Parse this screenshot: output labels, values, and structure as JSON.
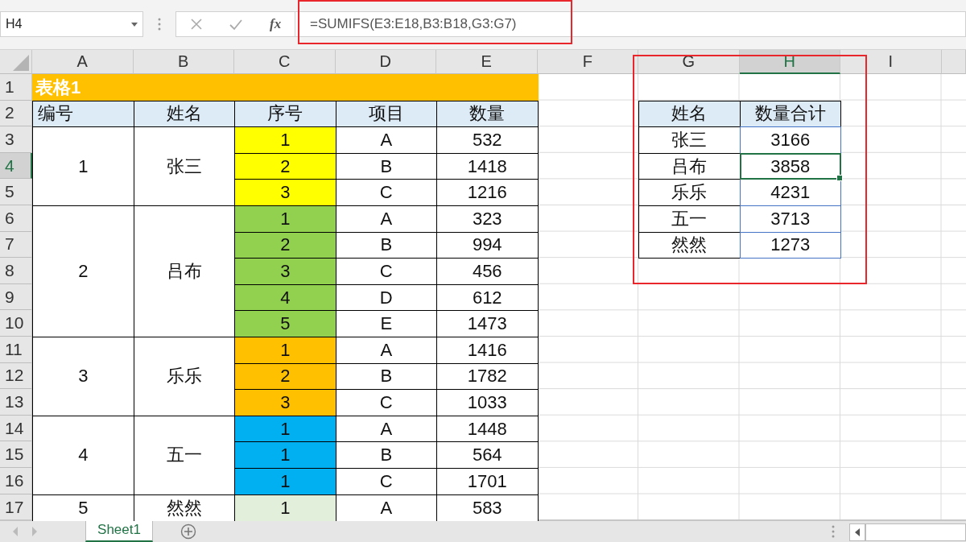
{
  "formula_bar": {
    "name_box": "H4",
    "fx": "fx",
    "formula": "=SUMIFS(E3:E18,B3:B18,G3:G7)"
  },
  "columns": [
    {
      "label": "A",
      "selected": false
    },
    {
      "label": "B",
      "selected": false
    },
    {
      "label": "C",
      "selected": false
    },
    {
      "label": "D",
      "selected": false
    },
    {
      "label": "E",
      "selected": false
    },
    {
      "label": "F",
      "selected": false
    },
    {
      "label": "G",
      "selected": false
    },
    {
      "label": "H",
      "selected": true
    },
    {
      "label": "I",
      "selected": false
    }
  ],
  "rows": [
    {
      "label": "1",
      "selected": false
    },
    {
      "label": "2",
      "selected": false
    },
    {
      "label": "3",
      "selected": false
    },
    {
      "label": "4",
      "selected": true
    },
    {
      "label": "5",
      "selected": false
    },
    {
      "label": "6",
      "selected": false
    },
    {
      "label": "7",
      "selected": false
    },
    {
      "label": "8",
      "selected": false
    },
    {
      "label": "9",
      "selected": false
    },
    {
      "label": "10",
      "selected": false
    },
    {
      "label": "11",
      "selected": false
    },
    {
      "label": "12",
      "selected": false
    },
    {
      "label": "13",
      "selected": false
    },
    {
      "label": "14",
      "selected": false
    },
    {
      "label": "15",
      "selected": false
    },
    {
      "label": "16",
      "selected": false
    },
    {
      "label": "17",
      "selected": false
    }
  ],
  "table": {
    "title": "表格1",
    "headers": [
      "编号",
      "姓名",
      "序号",
      "项目",
      "数量"
    ],
    "groups": [
      {
        "id": "1",
        "name": "张三",
        "items": [
          {
            "seq": "1",
            "color": "#ffff00",
            "item": "A",
            "qty": "532"
          },
          {
            "seq": "2",
            "color": "#ffff00",
            "item": "B",
            "qty": "1418"
          },
          {
            "seq": "3",
            "color": "#ffff00",
            "item": "C",
            "qty": "1216"
          }
        ]
      },
      {
        "id": "2",
        "name": "吕布",
        "items": [
          {
            "seq": "1",
            "color": "#92d050",
            "item": "A",
            "qty": "323"
          },
          {
            "seq": "2",
            "color": "#92d050",
            "item": "B",
            "qty": "994"
          },
          {
            "seq": "3",
            "color": "#92d050",
            "item": "C",
            "qty": "456"
          },
          {
            "seq": "4",
            "color": "#92d050",
            "item": "D",
            "qty": "612"
          },
          {
            "seq": "5",
            "color": "#92d050",
            "item": "E",
            "qty": "1473"
          }
        ]
      },
      {
        "id": "3",
        "name": "乐乐",
        "items": [
          {
            "seq": "1",
            "color": "#ffc000",
            "item": "A",
            "qty": "1416"
          },
          {
            "seq": "2",
            "color": "#ffc000",
            "item": "B",
            "qty": "1782"
          },
          {
            "seq": "3",
            "color": "#ffc000",
            "item": "C",
            "qty": "1033"
          }
        ]
      },
      {
        "id": "4",
        "name": "五一",
        "items": [
          {
            "seq": "1",
            "color": "#00b0f0",
            "item": "A",
            "qty": "1448"
          },
          {
            "seq": "1",
            "color": "#00b0f0",
            "item": "B",
            "qty": "564"
          },
          {
            "seq": "1",
            "color": "#00b0f0",
            "item": "C",
            "qty": "1701"
          }
        ]
      },
      {
        "id": "5",
        "name": "然然",
        "items": [
          {
            "seq": "1",
            "color": "#e2efda",
            "item": "A",
            "qty": "583"
          }
        ]
      }
    ]
  },
  "summary": {
    "headers": [
      "姓名",
      "数量合计"
    ],
    "rows": [
      {
        "name": "张三",
        "total": "3166",
        "selected": false
      },
      {
        "name": "吕布",
        "total": "3858",
        "selected": true
      },
      {
        "name": "乐乐",
        "total": "4231",
        "selected": false
      },
      {
        "name": "五一",
        "total": "3713",
        "selected": false
      },
      {
        "name": "然然",
        "total": "1273",
        "selected": false
      }
    ]
  },
  "sheet_tabs": [
    {
      "label": "Sheet1",
      "selected": true
    }
  ]
}
